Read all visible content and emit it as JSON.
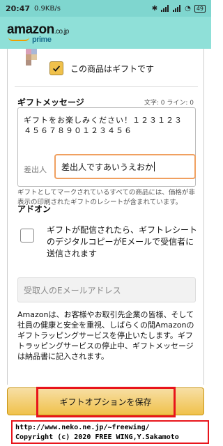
{
  "status_bar": {
    "time": "20:47",
    "speed": "0.9KB/s",
    "battery": "49"
  },
  "header": {
    "logo_text": "amazon",
    "logo_suffix": ".co.jp",
    "logo_prime": "prime"
  },
  "gift_check": {
    "label": "この商品はギフトです",
    "checked": true
  },
  "gift_message": {
    "title": "ギフトメッセージ",
    "counter": "文字: 0 ライン: 0",
    "text": "ギフトをお楽しみください！１２３１２３４５６７８９０１２３４５６",
    "sender_label": "差出人",
    "sender_value": "差出人ですあいうえおか"
  },
  "gift_note": "ギフトとしてマークされているすべての商品には、価格が非表示の印刷されたギフトのレシートが含まれています。",
  "addon": {
    "title": "アドオン",
    "digital_copy_label": "ギフトが配信されたら、ギフトレシートのデジタルコピーがEメールで受信者に送信されます",
    "digital_copy_checked": false,
    "email_placeholder": "受取人のEメールアドレス"
  },
  "info_text": "Amazonは、お客様やお取引先企業の皆様、そして社員の健康と安全を重視、しばらくの間Amazonのギフトラッピングサービスを停止いたします。ギフトラッピングサービスの停止中、ギフトメッセージは納品書に記入されます。",
  "save_button_label": "ギフトオプションを保存",
  "credit": {
    "line1": "http://www.neko.ne.jp/~freewing/",
    "line2": "Copyright (c) 2020 FREE WING,Y.Sakamoto"
  },
  "colors": {
    "header_bg": "#8fe0d8",
    "accent_yellow": "#f0c14b",
    "highlight_red": "#e8141b",
    "focus_orange": "#f0a060"
  }
}
